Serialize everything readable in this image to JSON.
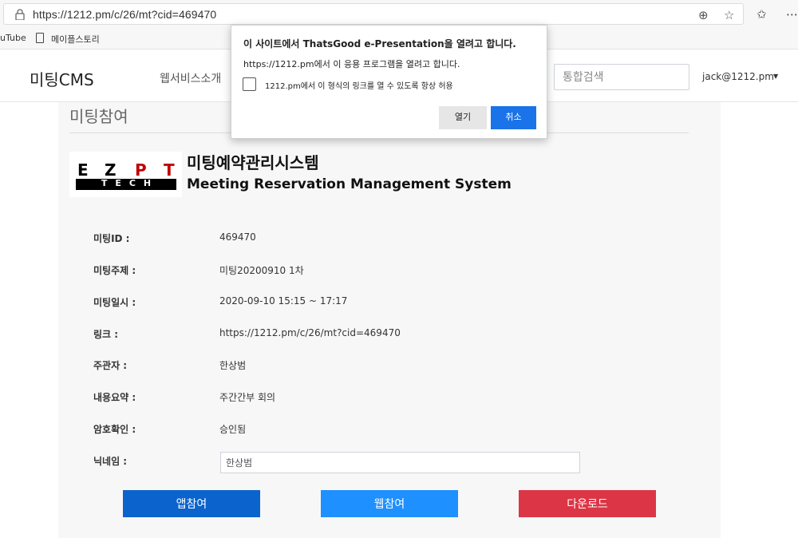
{
  "browser": {
    "url": "https://1212.pm/c/26/mt?cid=469470",
    "bookmarks": [
      "uTube",
      "메이플스토리"
    ]
  },
  "navbar": {
    "brand": "미팅CMS",
    "nav_link": "웹서비스소개",
    "search_placeholder": "통합검색",
    "user": "jack@1212.pm"
  },
  "page": {
    "title": "미팅참여",
    "logo": {
      "letters": [
        "E",
        "Z",
        "P",
        "T"
      ],
      "subtitle": "TECH"
    },
    "system_name_kr": "미팅예약관리시스템",
    "system_name_en": "Meeting Reservation Management System",
    "fields": [
      {
        "label": "미팅ID :",
        "value": "469470"
      },
      {
        "label": "미팅주제 :",
        "value": "미팅20200910 1차"
      },
      {
        "label": "미팅일시 :",
        "value": "2020-09-10 15:15 ~ 17:17"
      },
      {
        "label": "링크 :",
        "value": "https://1212.pm/c/26/mt?cid=469470"
      },
      {
        "label": "주관자 :",
        "value": "한상범"
      },
      {
        "label": "내용요약 :",
        "value": "주간간부 회의"
      },
      {
        "label": "암호확인 :",
        "value": "승인됨"
      }
    ],
    "nickname": {
      "label": "닉네임 :",
      "value": "한상범"
    },
    "buttons": {
      "app_join": "앱참여",
      "web_join": "웹참여",
      "download": "다운로드"
    }
  },
  "dialog": {
    "title": "이 사이트에서 ThatsGood e-Presentation을 열려고 합니다.",
    "message": "https://1212.pm에서 이 응용 프로그램을 열려고 합니다.",
    "checkbox_label": "1212.pm에서 이 형식의 링크를 열 수 있도록 항상 허용",
    "open_label": "열기",
    "cancel_label": "취소"
  },
  "colors": {
    "app_join": "#0b63ce",
    "web_join": "#1e90ff",
    "download": "#dc3545",
    "dialog_primary": "#1a73e8",
    "logo_red": "#c00000"
  },
  "icons": [
    "lock-icon",
    "zoom-icon",
    "star-icon",
    "favorites-icon",
    "more-icon",
    "document-icon",
    "caret-down-icon"
  ]
}
